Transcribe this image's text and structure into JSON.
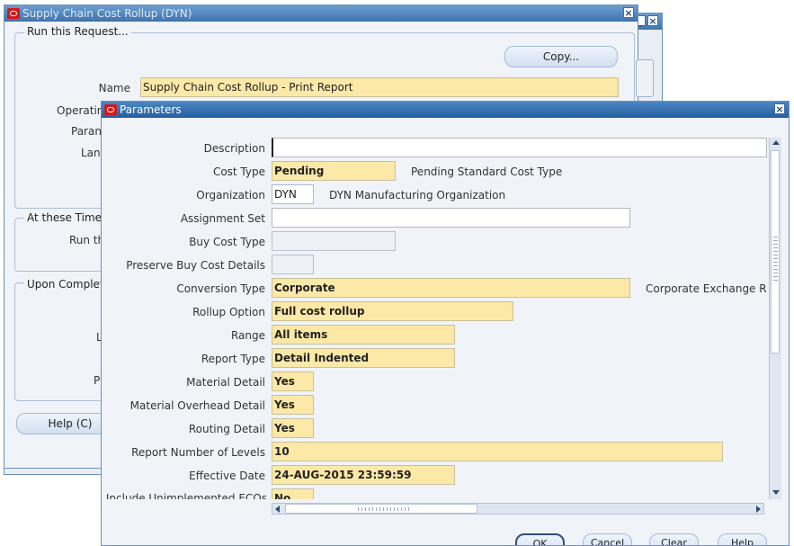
{
  "back_window": {
    "title": "Supply Chain Cost Rollup (DYN)",
    "run_request_label": "Run this Request...",
    "copy_button": "Copy...",
    "name_label": "Name",
    "name_value": "Supply Chain Cost Rollup - Print Report",
    "operating_label": "Operatin",
    "parameters_label": "Paran",
    "language_label": "Lan",
    "schedule_group_label": "At these Time",
    "run_label": "Run th",
    "upon_completion_label": "Upon Complet",
    "layout_label": "L",
    "print_label": "P",
    "help_button": "Help (C)"
  },
  "dialog": {
    "title": "Parameters",
    "fields": [
      {
        "label": "Description",
        "value": "",
        "desc": ""
      },
      {
        "label": "Cost Type",
        "value": "Pending",
        "desc": "Pending Standard Cost Type"
      },
      {
        "label": "Organization",
        "value": "DYN",
        "desc": "DYN Manufacturing Organization"
      },
      {
        "label": "Assignment Set",
        "value": "",
        "desc": ""
      },
      {
        "label": "Buy Cost Type",
        "value": "",
        "desc": ""
      },
      {
        "label": "Preserve Buy Cost Details",
        "value": "",
        "desc": ""
      },
      {
        "label": "Conversion Type",
        "value": "Corporate",
        "desc": "Corporate Exchange Ra"
      },
      {
        "label": "Rollup Option",
        "value": "Full cost rollup",
        "desc": ""
      },
      {
        "label": "Range",
        "value": "All items",
        "desc": ""
      },
      {
        "label": "Report Type",
        "value": "Detail Indented",
        "desc": ""
      },
      {
        "label": "Material Detail",
        "value": "Yes",
        "desc": ""
      },
      {
        "label": "Material Overhead Detail",
        "value": "Yes",
        "desc": ""
      },
      {
        "label": "Routing Detail",
        "value": "Yes",
        "desc": ""
      },
      {
        "label": "Report Number of Levels",
        "value": "10",
        "desc": ""
      },
      {
        "label": "Effective Date",
        "value": "24-AUG-2015 23:59:59",
        "desc": ""
      },
      {
        "label": "Include Unimplemented ECOs",
        "value": "No",
        "desc": ""
      }
    ],
    "buttons": [
      "OK",
      "Cancel",
      "Clear",
      "Help"
    ]
  }
}
